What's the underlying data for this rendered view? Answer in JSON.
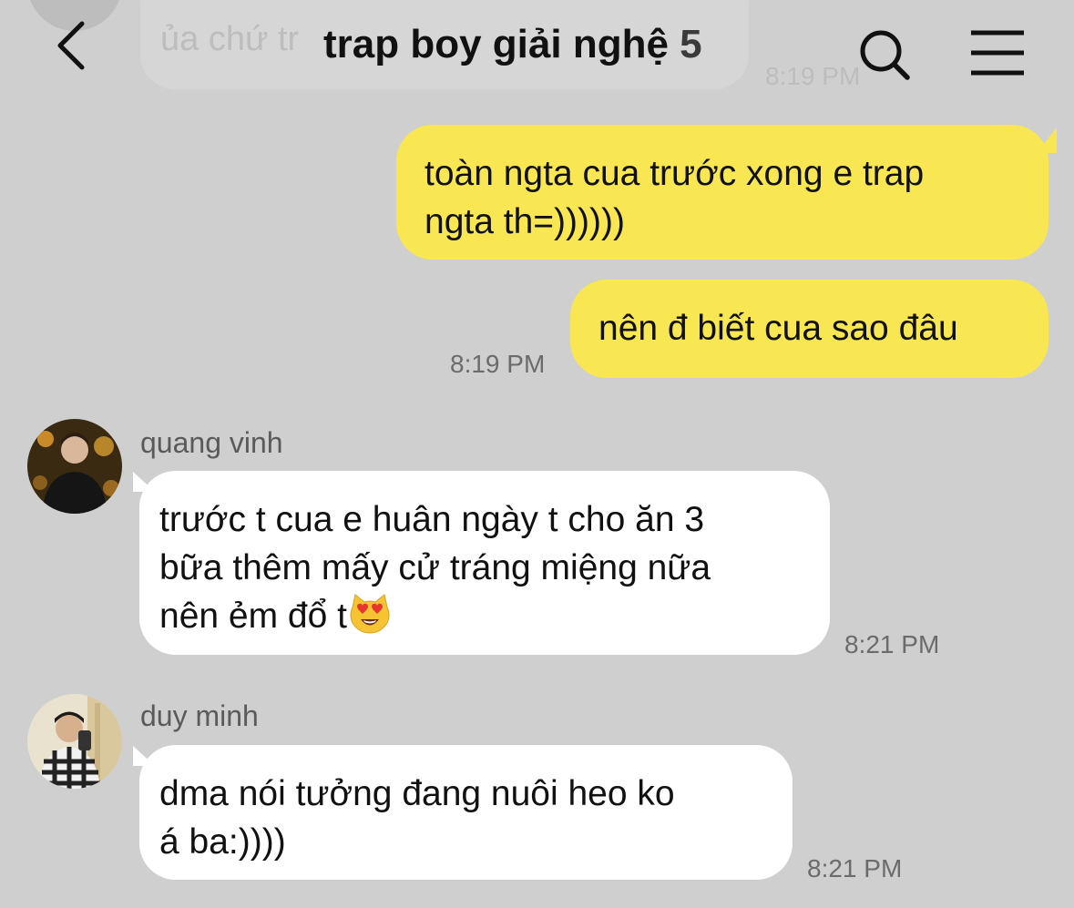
{
  "header": {
    "title": "trap boy giải nghệ",
    "member_count": "5",
    "back_icon": "chevron-left-icon",
    "search_icon": "search-icon",
    "menu_icon": "menu-icon"
  },
  "faded_message": {
    "text": "ủa chứ tr",
    "time": "8:19 PM"
  },
  "messages": [
    {
      "direction": "outgoing",
      "text": "toàn ngta cua trước xong e trap\nngta th=))))))"
    },
    {
      "direction": "outgoing",
      "text": "nên đ biết cua sao đâu",
      "time": "8:19 PM"
    },
    {
      "direction": "incoming",
      "sender": "quang vinh",
      "text": "trước t cua e huân ngày t cho ăn 3\nbữa thêm mấy cử tráng miệng nữa\nnên ẻm đổ t",
      "emoji": "heart-eyes-cat-emoji",
      "time": "8:21 PM"
    },
    {
      "direction": "incoming",
      "sender": "duy minh",
      "text": "dma nói tưởng đang nuôi heo ko\ná ba:))))",
      "time": "8:21 PM"
    }
  ],
  "colors": {
    "background": "#cfcfcf",
    "outgoing_bubble": "#f8e653",
    "incoming_bubble": "#ffffff",
    "timestamp": "#6b6b6b"
  }
}
